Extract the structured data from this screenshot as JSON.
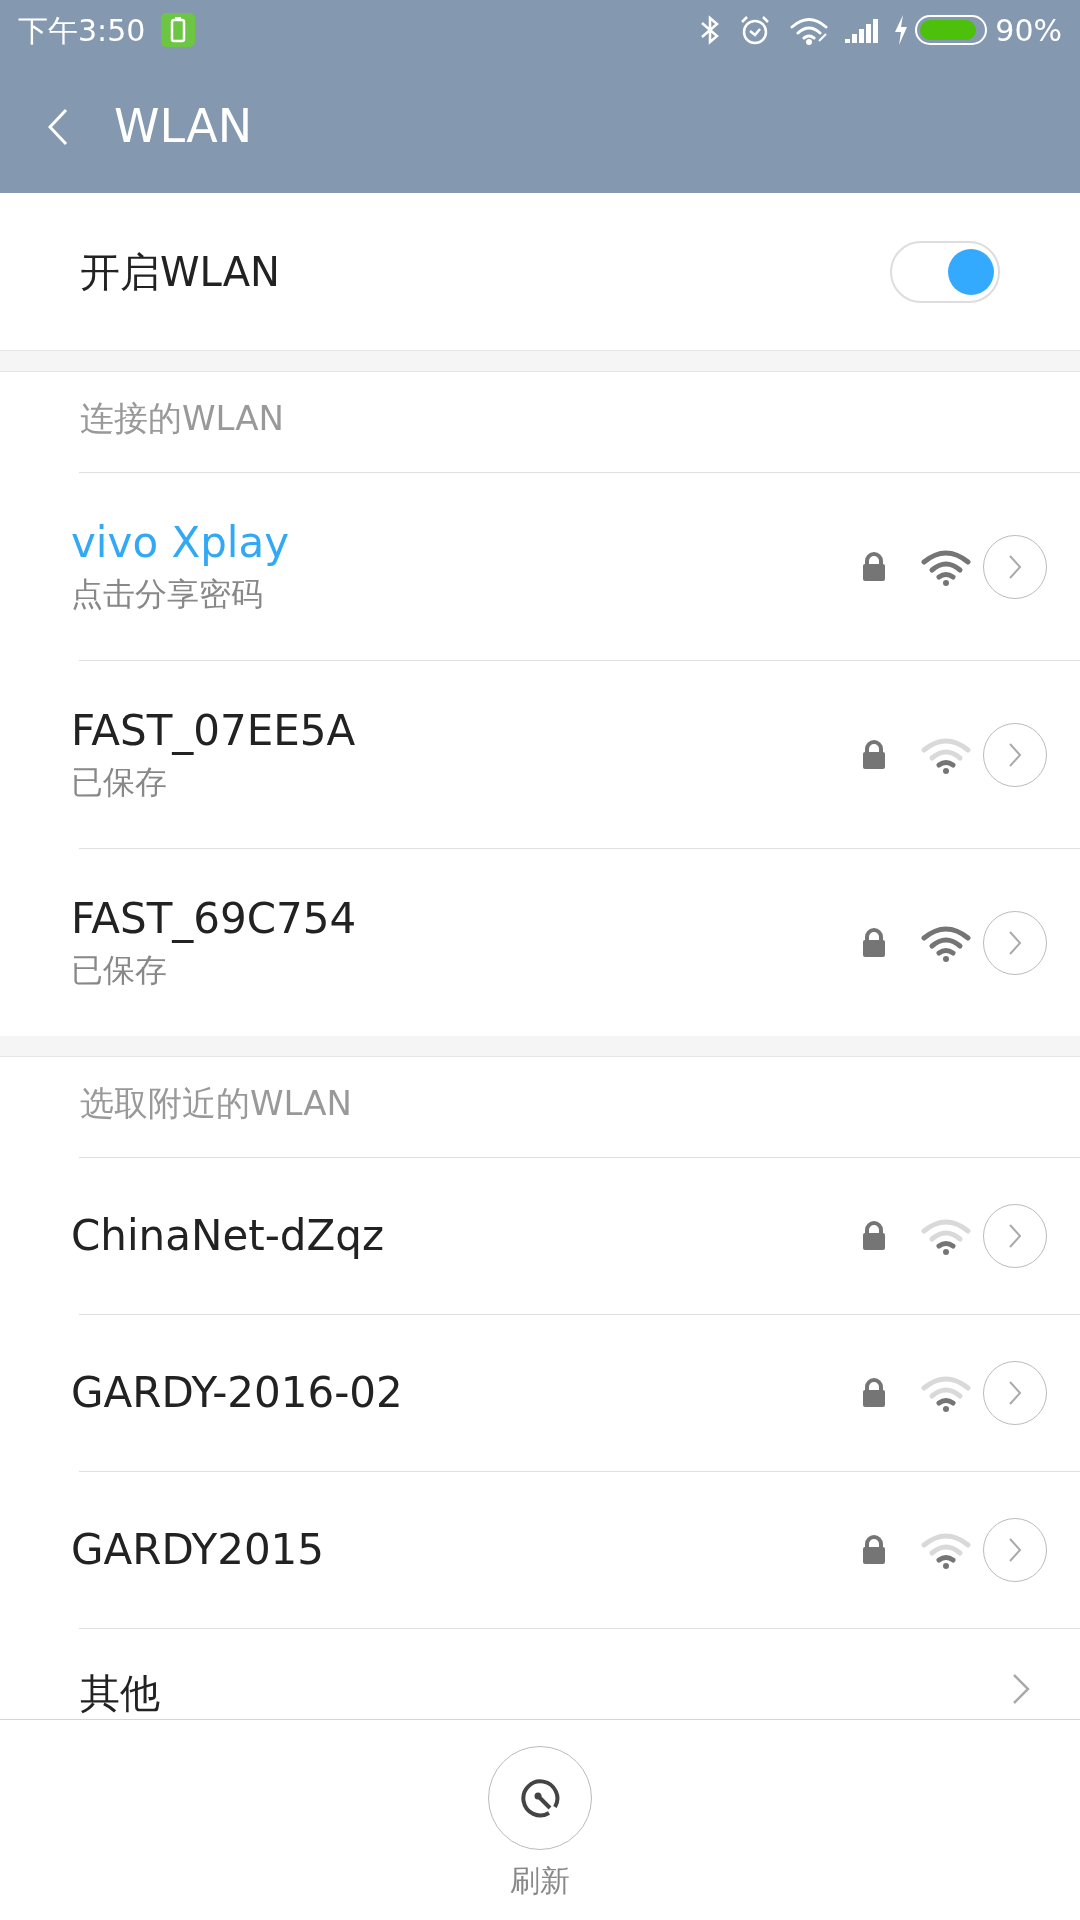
{
  "status_bar": {
    "time": "下午3:50",
    "battery": "90%",
    "charging": true
  },
  "header": {
    "title": "WLAN"
  },
  "wlan_toggle": {
    "label": "开启WLAN",
    "on": true
  },
  "sections": [
    {
      "title": "连接的WLAN",
      "networks": [
        {
          "name": "vivo Xplay",
          "subtitle": "点击分享密码",
          "connected": true,
          "locked": true,
          "strong_signal": true
        },
        {
          "name": "FAST_07EE5A",
          "subtitle": "已保存",
          "connected": false,
          "locked": true,
          "strong_signal": false
        },
        {
          "name": "FAST_69C754",
          "subtitle": "已保存",
          "connected": false,
          "locked": true,
          "strong_signal": true
        }
      ]
    },
    {
      "title": "选取附近的WLAN",
      "networks": [
        {
          "name": "ChinaNet-dZqz",
          "connected": false,
          "locked": true,
          "strong_signal": false
        },
        {
          "name": "GARDY-2016-02",
          "connected": false,
          "locked": true,
          "strong_signal": false
        },
        {
          "name": "GARDY2015",
          "connected": false,
          "locked": true,
          "strong_signal": false
        }
      ]
    }
  ],
  "other": {
    "label": "其他"
  },
  "refresh": {
    "label": "刷新"
  }
}
